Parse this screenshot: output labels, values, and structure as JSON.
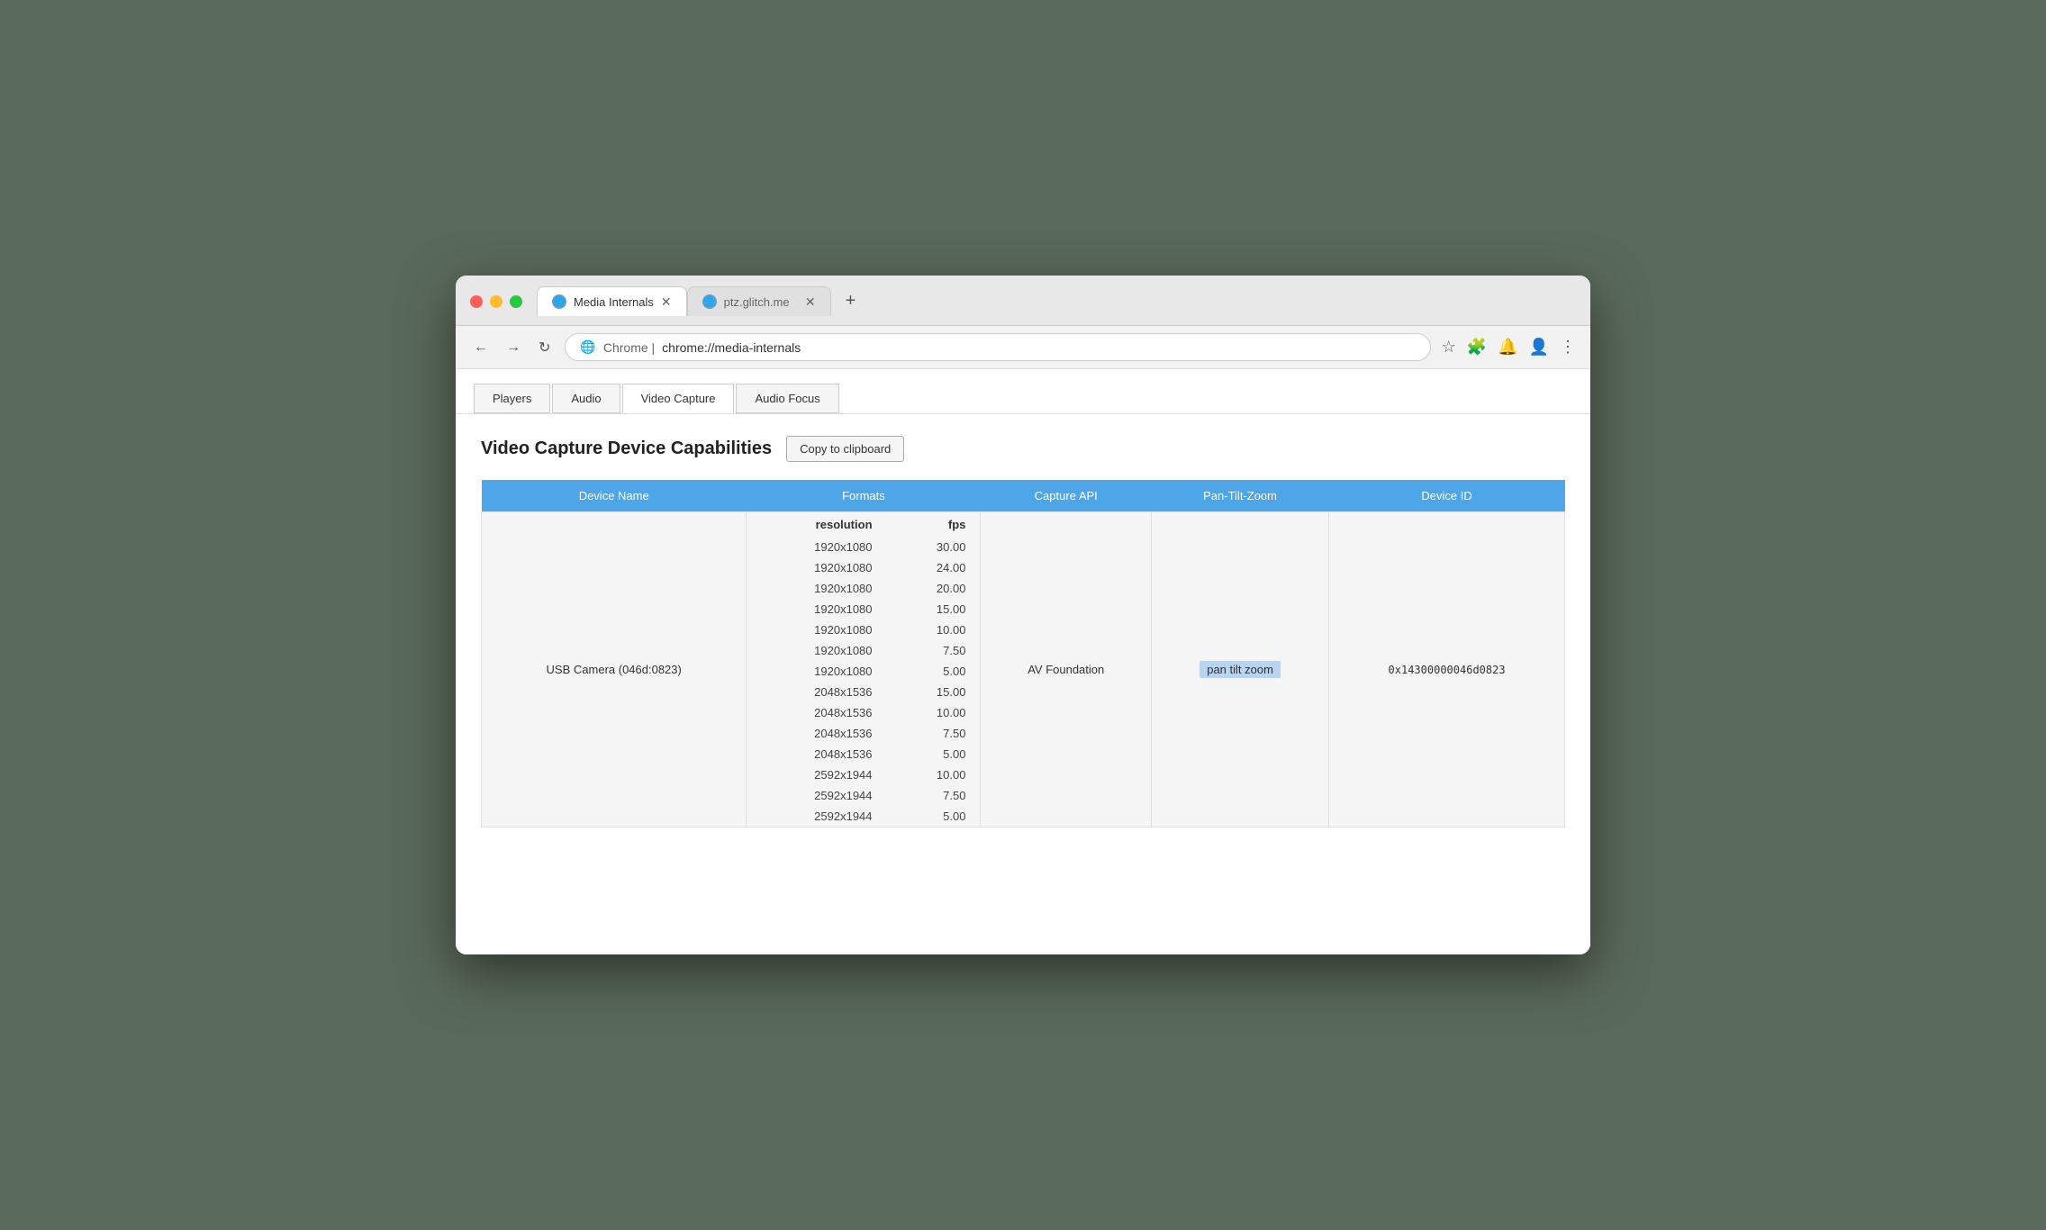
{
  "window": {
    "controls": {
      "close": "×",
      "minimize": "–",
      "maximize": "+"
    }
  },
  "browser": {
    "tabs": [
      {
        "id": "media-internals",
        "icon": "🌐",
        "label": "Media Internals",
        "active": true
      },
      {
        "id": "ptz-glitch",
        "icon": "🌐",
        "label": "ptz.glitch.me",
        "active": false
      }
    ],
    "add_tab_label": "+",
    "address": {
      "icon": "🌐",
      "prefix": "Chrome | ",
      "url": "chrome://media-internals"
    },
    "toolbar": {
      "star": "☆",
      "extensions": "🧩",
      "bell": "🔔",
      "profile": "👤",
      "menu": "⋮"
    }
  },
  "internal_tabs": [
    {
      "id": "players",
      "label": "Players",
      "active": false
    },
    {
      "id": "audio",
      "label": "Audio",
      "active": false
    },
    {
      "id": "video-capture",
      "label": "Video Capture",
      "active": true
    },
    {
      "id": "audio-focus",
      "label": "Audio Focus",
      "active": false
    }
  ],
  "page": {
    "section_title": "Video Capture Device Capabilities",
    "copy_button_label": "Copy to clipboard",
    "table": {
      "headers": [
        "Device Name",
        "Formats",
        "Capture API",
        "Pan-Tilt-Zoom",
        "Device ID"
      ],
      "formats_sub_headers": [
        "resolution",
        "fps"
      ],
      "rows": [
        {
          "device_name": "USB Camera (046d:0823)",
          "formats": [
            {
              "resolution": "1920x1080",
              "fps": "30.00"
            },
            {
              "resolution": "1920x1080",
              "fps": "24.00"
            },
            {
              "resolution": "1920x1080",
              "fps": "20.00"
            },
            {
              "resolution": "1920x1080",
              "fps": "15.00"
            },
            {
              "resolution": "1920x1080",
              "fps": "10.00"
            },
            {
              "resolution": "1920x1080",
              "fps": "7.50"
            },
            {
              "resolution": "1920x1080",
              "fps": "5.00"
            },
            {
              "resolution": "2048x1536",
              "fps": "15.00"
            },
            {
              "resolution": "2048x1536",
              "fps": "10.00"
            },
            {
              "resolution": "2048x1536",
              "fps": "7.50"
            },
            {
              "resolution": "2048x1536",
              "fps": "5.00"
            },
            {
              "resolution": "2592x1944",
              "fps": "10.00"
            },
            {
              "resolution": "2592x1944",
              "fps": "7.50"
            },
            {
              "resolution": "2592x1944",
              "fps": "5.00"
            }
          ],
          "capture_api": "AV Foundation",
          "ptz": "pan tilt zoom",
          "device_id": "0x14300000046d0823"
        }
      ]
    }
  }
}
